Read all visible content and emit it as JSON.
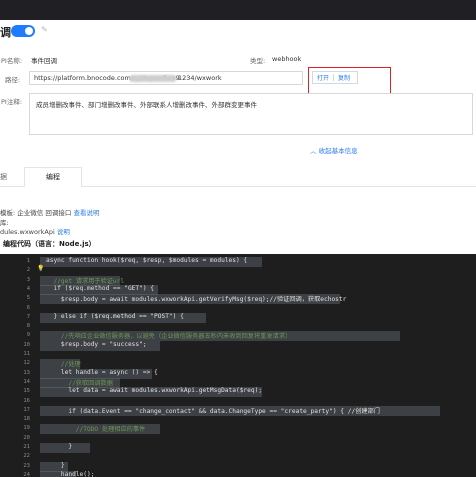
{
  "header": {
    "title": "调",
    "toggle_on": true
  },
  "form": {
    "api_name_label": "PI名称:",
    "api_name_value": "事件回调",
    "type_label": "类型:",
    "type_value": "webhook",
    "path_label": "路径:",
    "path_prefix": "https://platform.bnocode.com/api/open/5ee9",
    "path_suffix": "1234/wxwork",
    "open_label": "打开",
    "copy_label": "复制",
    "note_label": "PI注释:",
    "note_value": "成员增删改事件、部门增删改事件、外部联系人增删改事件、外部群变更事件",
    "collapse_label": "收起基本信息"
  },
  "tabs": [
    {
      "label": "据"
    },
    {
      "label": "编程"
    }
  ],
  "meta": {
    "template_label": "模板:",
    "template_value": "企业微信 回调接口",
    "template_link": "查看说明",
    "lib_label": "库:",
    "lib_value": "dules.wxworkApi",
    "lib_link": "说明"
  },
  "code_title": "编程代码（语言：Node.js）",
  "editor": {
    "lines": [
      {
        "n": "1",
        "text": "async function hook($req, $resp, $modules = modules) {"
      },
      {
        "n": "2",
        "text": ""
      },
      {
        "n": "3",
        "text": "  //get 请求用于验证url"
      },
      {
        "n": "4",
        "text": "  if ($req.method == \"GET\") {"
      },
      {
        "n": "5",
        "text": "    $resp.body = await modules.wxworkApi.getVerifyMsg($req);//验证回调，获取echostr"
      },
      {
        "n": "6",
        "text": ""
      },
      {
        "n": "7",
        "text": "  } else if ($req.method == \"POST\") {"
      },
      {
        "n": "8",
        "text": ""
      },
      {
        "n": "9",
        "text": "    //先响应企业微信服务器，以避免（企业微信服务器五秒内未收到回复将重发请求）"
      },
      {
        "n": "10",
        "text": "    $resp.body = \"success\";"
      },
      {
        "n": "11",
        "text": ""
      },
      {
        "n": "12",
        "text": "    //处理"
      },
      {
        "n": "13",
        "text": "    let handle = async () => {"
      },
      {
        "n": "14",
        "text": "      //获取回调数据"
      },
      {
        "n": "15",
        "text": "      let data = await modules.wxworkApi.getMsgData($req);"
      },
      {
        "n": "16",
        "text": ""
      },
      {
        "n": "17",
        "text": "      if (data.Event == \"change_contact\" && data.ChangeType == \"create_party\") { //创建部门"
      },
      {
        "n": "18",
        "text": ""
      },
      {
        "n": "19",
        "text": "        //TODO 处理相应的事件"
      },
      {
        "n": "20",
        "text": ""
      },
      {
        "n": "21",
        "text": "      }"
      },
      {
        "n": "22",
        "text": ""
      },
      {
        "n": "23",
        "text": "    }"
      },
      {
        "n": "24",
        "text": "    handle();"
      }
    ]
  },
  "colors": {
    "accent": "#1f7cff",
    "link": "#2b7ce9",
    "highlight_box": "#e02020",
    "editor_bg": "#1e1e1e"
  }
}
